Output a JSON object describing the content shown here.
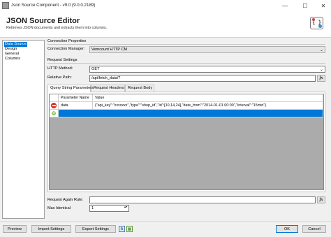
{
  "window": {
    "title": "Json Source Component - v9.0 (9.0.0.2189)",
    "minimize_glyph": "—",
    "maximize_glyph": "☐",
    "close_glyph": "✕"
  },
  "header": {
    "title": "JSON Source Editor",
    "subtitle": "Retrieves JSON documents and extracts them into columns."
  },
  "nav": {
    "items": [
      "Data Source",
      "Design",
      "General",
      "Columns"
    ],
    "selected": 0
  },
  "connection": {
    "section": "Connection Properties",
    "manager_label": "Connection Manager:",
    "manager_value": "Vemcount HTTP CM"
  },
  "request": {
    "section": "Request Settings",
    "method_label": "HTTP Method:",
    "method_value": "GET",
    "path_label": "Relative Path:",
    "path_value": "/api/fetch_data/?"
  },
  "tabs": [
    "Query String Parameters",
    "Request Headers",
    "Request Body"
  ],
  "grid": {
    "columns": [
      "Parameter Name",
      "Value"
    ],
    "rows": [
      {
        "name": "data",
        "value": "{\"api_key\":\"xxxxxxx\",\"type\":\"shop_id\",\"id\":[10,14,24],\"date_from\":\"2014-01-01 00:00\",\"interval\":\"15min\"}"
      }
    ]
  },
  "again": {
    "rule_label": "Request Again Rule:",
    "rule_value": "",
    "max_label": "Max Identical",
    "max_value": "1"
  },
  "buttons": {
    "preview": "Preview",
    "import": "Import Settings",
    "export": "Export Settings",
    "ok": "OK",
    "cancel": "Cancel"
  },
  "icons": {
    "fx": "fx",
    "caret": "⌄",
    "spin": "▴▾"
  },
  "colors": {
    "accent": "#0078d7",
    "remove": "#d93025",
    "add": "#7ac142"
  }
}
